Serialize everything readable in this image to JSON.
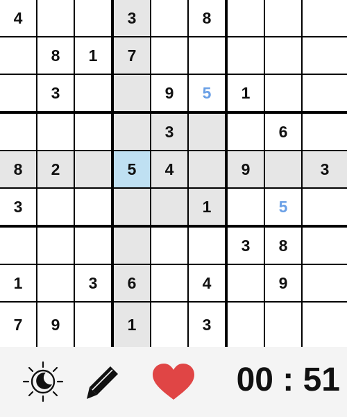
{
  "board": {
    "rows": [
      [
        "4",
        "",
        "",
        "3",
        "",
        "8",
        "",
        "",
        ""
      ],
      [
        "",
        "8",
        "1",
        "7",
        "",
        "",
        "",
        "",
        ""
      ],
      [
        "",
        "3",
        "",
        "",
        "9",
        "5",
        "1",
        "",
        ""
      ],
      [
        "",
        "",
        "",
        "",
        "3",
        "",
        "",
        "6",
        ""
      ],
      [
        "8",
        "2",
        "",
        "5",
        "4",
        "",
        "9",
        "",
        "3"
      ],
      [
        "3",
        "",
        "",
        "",
        "",
        "1",
        "",
        "5",
        ""
      ],
      [
        "",
        "",
        "",
        "",
        "",
        "",
        "3",
        "8",
        ""
      ],
      [
        "1",
        "",
        "3",
        "6",
        "",
        "4",
        "",
        "9",
        ""
      ],
      [
        "7",
        "9",
        "",
        "1",
        "",
        "3",
        "",
        "",
        ""
      ]
    ],
    "user_entries": [
      [
        2,
        5
      ],
      [
        5,
        7
      ]
    ],
    "selected_cell": [
      4,
      3
    ]
  },
  "toolbar": {
    "theme_toggle_icon": "sun-moon-icon",
    "pencil_icon": "pencil-icon",
    "lives_icon": "heart-icon",
    "timer": "00 : 51"
  },
  "colors": {
    "highlight": "#e6e6e6",
    "selected": "#bfe0f2",
    "user_digit": "#6aa0e6",
    "heart": "#e04545"
  }
}
